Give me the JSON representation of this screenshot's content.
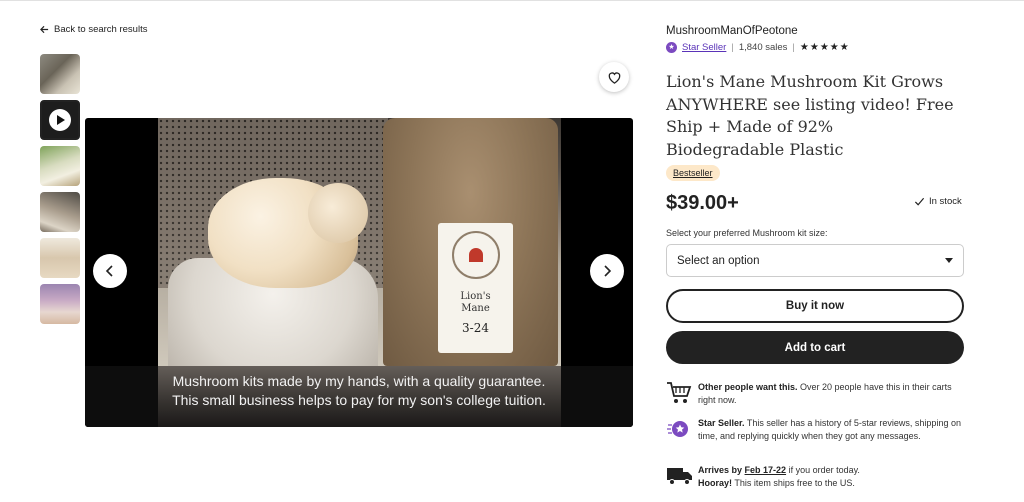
{
  "nav": {
    "back_label": "Back to search results"
  },
  "gallery": {
    "thumbnail_count": 6,
    "selected_index": 1,
    "caption_line1": "Mushroom kits made by my hands, with a quality guarantee.",
    "caption_line2": "This small business helps to pay for my son's college tuition.",
    "bag_label_line1": "Lion's",
    "bag_label_line2": "Mane",
    "bag_label_line3": "3-24"
  },
  "shop": {
    "name": "MushroomManOfPeotone",
    "star_seller": "Star Seller",
    "sales": "1,840 sales",
    "rating_stars": "★★★★★",
    "rating": 5
  },
  "listing": {
    "title": "Lion's Mane Mushroom Kit Grows ANYWHERE see listing video! Free Ship + Made of 92% Biodegradable Plastic",
    "badge": "Bestseller",
    "price": "$39.00+",
    "stock": "In stock",
    "select_label": "Select your preferred Mushroom kit size:",
    "select_value": "Select an option",
    "buy_now": "Buy it now",
    "add_to_cart": "Add to cart"
  },
  "highlights": [
    {
      "icon": "cart-icon",
      "title": "Other people want this.",
      "text": " Over 20 people have this in their carts right now."
    },
    {
      "icon": "star-seller-icon",
      "title": "Star Seller.",
      "text": " This seller has a history of 5-star reviews, shipping on time, and replying quickly when they got any messages."
    },
    {
      "icon": "truck-icon",
      "arrives_prefix": "Arrives by ",
      "arrives_date": "Feb 17-22",
      "arrives_suffix": " if you order today.",
      "hooray": "Hooray!",
      "hooray_text": " This item ships free to the US."
    }
  ],
  "colors": {
    "accent": "#222222",
    "star_seller": "#7b4ac0",
    "badge_bg": "#fde8c9"
  }
}
